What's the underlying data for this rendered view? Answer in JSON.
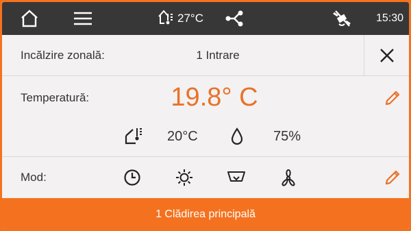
{
  "topbar": {
    "home_icon": "home-icon",
    "menu_icon": "hamburger-menu-icon",
    "outdoor_temperature": "27°C",
    "network_icon": "network-share-icon",
    "status_icon": "no-satellite-icon",
    "time": "15:30"
  },
  "zone": {
    "label": "Incălzire zonală:",
    "value": "1 Intrare"
  },
  "temperature": {
    "label": "Temperatură:",
    "current": "19.8° C",
    "setpoint": "20°C",
    "humidity": "75%"
  },
  "mode": {
    "label": "Mod:",
    "icons": [
      "clock-icon",
      "sun-icon",
      "setback-icon",
      "fan-icon"
    ]
  },
  "footer": {
    "label": "1 Clădirea principală"
  },
  "colors": {
    "accent": "#e8722a",
    "topbar": "#373737",
    "background": "#f3f1f1"
  }
}
